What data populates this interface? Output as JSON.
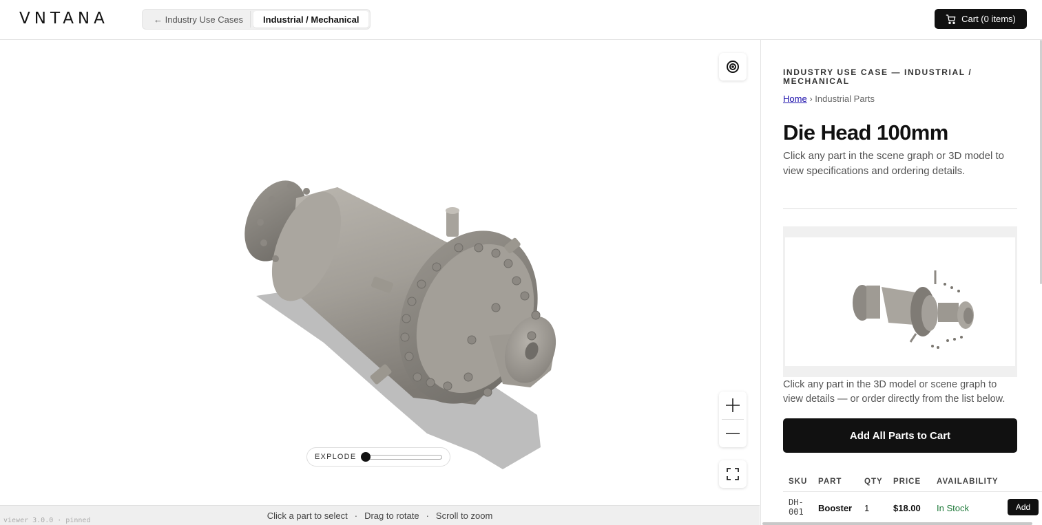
{
  "header": {
    "logo": "VNTANA",
    "back_label": "← Industry Use Cases",
    "current_label": "Industrial / Mechanical",
    "cart_label": "Cart (0 items)"
  },
  "viewer": {
    "explode_label": "EXPLODE",
    "explode_value": 0,
    "hints": [
      "Click a part to select",
      "·",
      "Drag to rotate",
      "·",
      "Scroll to zoom"
    ],
    "version": "viewer 3.0.0 · pinned",
    "icons": {
      "target": "target-icon",
      "zoom_in": "plus-icon",
      "zoom_out": "minus-icon",
      "fullscreen": "fullscreen-icon"
    }
  },
  "panel": {
    "eyebrow": "INDUSTRY USE CASE — INDUSTRIAL / MECHANICAL",
    "breadcrumb_home": "Home",
    "breadcrumb_sep": "›",
    "breadcrumb_current": "Industrial Parts",
    "title": "Die Head 100mm",
    "description": "Click any part in the scene graph or 3D model to view specifications and ordering details.",
    "hint": "Click any part in the 3D model or scene graph to view details — or order directly from the list below.",
    "add_all_label": "Add All Parts to Cart",
    "table": {
      "headers": {
        "sku": "SKU",
        "part": "PART",
        "qty": "QTY",
        "price": "PRICE",
        "availability": "AVAILABILITY"
      },
      "rows": [
        {
          "sku": "DH-001",
          "part": "Booster",
          "qty": "1",
          "price": "$18.00",
          "availability": "In Stock",
          "action": "Add"
        }
      ]
    }
  },
  "colors": {
    "accent": "#111111",
    "in_stock": "#1f7a3a",
    "link": "#1a0dab"
  }
}
